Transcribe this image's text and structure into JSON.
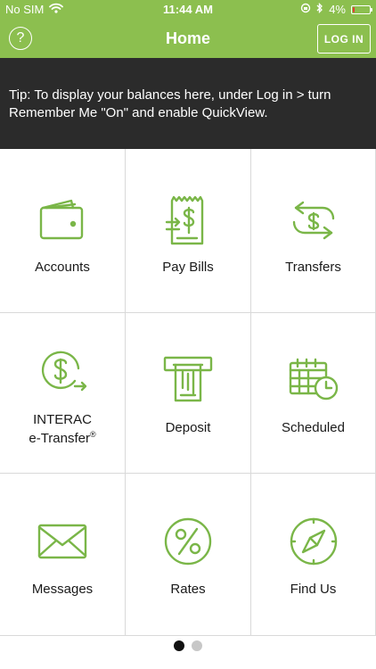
{
  "status_bar": {
    "carrier": "No SIM",
    "time": "11:44 AM",
    "battery_percent": "4%",
    "battery_level": 0.04,
    "icons": [
      "wifi-icon",
      "rotation-lock-icon",
      "bluetooth-icon",
      "battery-icon"
    ]
  },
  "nav": {
    "title": "Home",
    "help_label": "?",
    "login_label": "LOG IN"
  },
  "tip": {
    "text": "Tip: To display your balances here, under Log in > turn Remember Me \"On\" and enable QuickView."
  },
  "colors": {
    "brand_green": "#8cbf4f",
    "icon_green": "#7ab648",
    "tip_background": "#2b2b2b"
  },
  "tiles": [
    {
      "id": "accounts",
      "label": "Accounts",
      "icon": "wallet-icon"
    },
    {
      "id": "pay-bills",
      "label": "Pay Bills",
      "icon": "bill-icon"
    },
    {
      "id": "transfers",
      "label": "Transfers",
      "icon": "transfer-icon"
    },
    {
      "id": "interac",
      "label_line1": "INTERAC",
      "label_line2": "e-Transfer",
      "label_mark": "®",
      "icon": "etransfer-icon"
    },
    {
      "id": "deposit",
      "label": "Deposit",
      "icon": "deposit-icon"
    },
    {
      "id": "scheduled",
      "label": "Scheduled",
      "icon": "calendar-clock-icon"
    },
    {
      "id": "messages",
      "label": "Messages",
      "icon": "envelope-icon"
    },
    {
      "id": "rates",
      "label": "Rates",
      "icon": "percent-icon"
    },
    {
      "id": "find-us",
      "label": "Find Us",
      "icon": "compass-icon"
    }
  ],
  "pager": {
    "total_pages": 2,
    "current_page": 1
  }
}
